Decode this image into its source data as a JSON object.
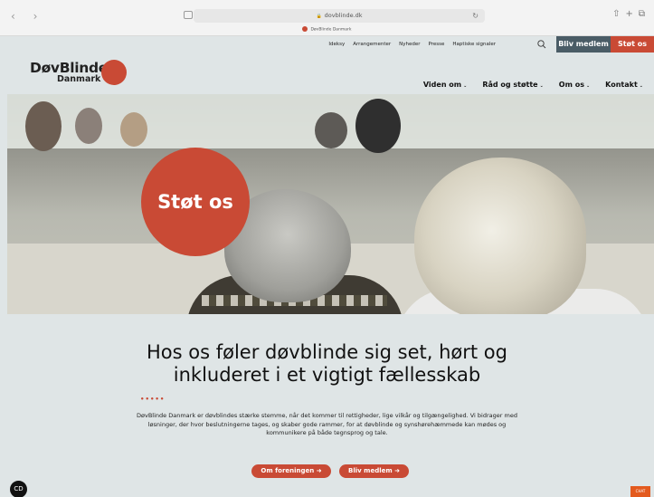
{
  "browser": {
    "url": "dovblinde.dk",
    "tab_title": "DøvBlinde Danmark"
  },
  "utility_nav": {
    "links": [
      "Ideksy",
      "Arrangementer",
      "Nyheder",
      "Presse",
      "Haptiske signaler"
    ],
    "member_button": "Bliv medlem",
    "support_button": "Støt os"
  },
  "logo": {
    "line1": "DøvBlinde",
    "line2": "Danmark"
  },
  "main_nav": [
    "Viden om",
    "Råd og støtte",
    "Om os",
    "Kontakt"
  ],
  "hero": {
    "badge": "Støt os"
  },
  "content": {
    "headline_line1": "Hos os føler døvblinde sig set, hørt og",
    "headline_line2": "inkluderet i et vigtigt fællesskab",
    "dots": "•••••",
    "paragraph": "DøvBlinde Danmark er døvblindes stærke stemme, når det kommer til rettigheder, lige vilkår og tilgængelighed. Vi bidrager med løsninger, der hvor beslutningerne tages, og skaber gode rammer, for at døvblinde og synshørehæmmede kan mødes og kommunikere på både tegnsprog og tale.",
    "cta_about": "Om foreningen",
    "cta_member": "Bliv medlem"
  },
  "widgets": {
    "chat_label": "CHAT"
  },
  "colors": {
    "brand_red": "#c94a35",
    "slate": "#4a5c66",
    "background": "#dfe5e6"
  }
}
